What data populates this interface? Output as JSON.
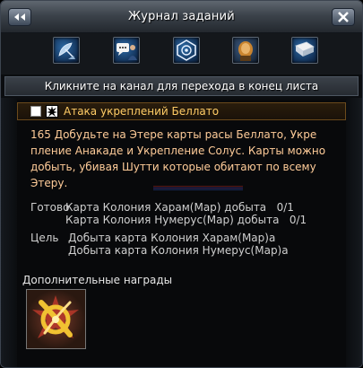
{
  "window": {
    "title": "Журнал заданий"
  },
  "toolbar": {
    "icons": [
      "radar-dish-icon",
      "chat-bubble-icon",
      "faction-emblem-icon",
      "portrait-icon",
      "book-icon"
    ]
  },
  "channel": {
    "hint": "Кликните на канал для перехода в конец листа"
  },
  "quest": {
    "title": "Атака укреплений Беллато",
    "description_lines": [
      "165  Добудьте на Этере карты расы Беллато, Укре",
      "пление Анакаде и Укрепление Солус. Карты можно",
      " добыть, убивая Шутти которые обитают по всему",
      "Этеру."
    ],
    "progress_label": "Готово",
    "progress_lines": [
      "Карта Колония Харам(Мар) добыта   0/1",
      "Карта Колония Нумерус(Мар) добыта   0/1"
    ],
    "goal_label": "Цель",
    "goal_lines": [
      "Добыта карта Колония Харам(Мар)а",
      "Добыта карта Колония Нумерус(Мар)а"
    ]
  },
  "rewards": {
    "title": "Дополнительные награды",
    "item_icon": "golden-emblem-icon"
  },
  "colors": {
    "quest_title": "#ffcc66",
    "description": "#ffcc99",
    "normal_text": "#cfcfcf"
  }
}
